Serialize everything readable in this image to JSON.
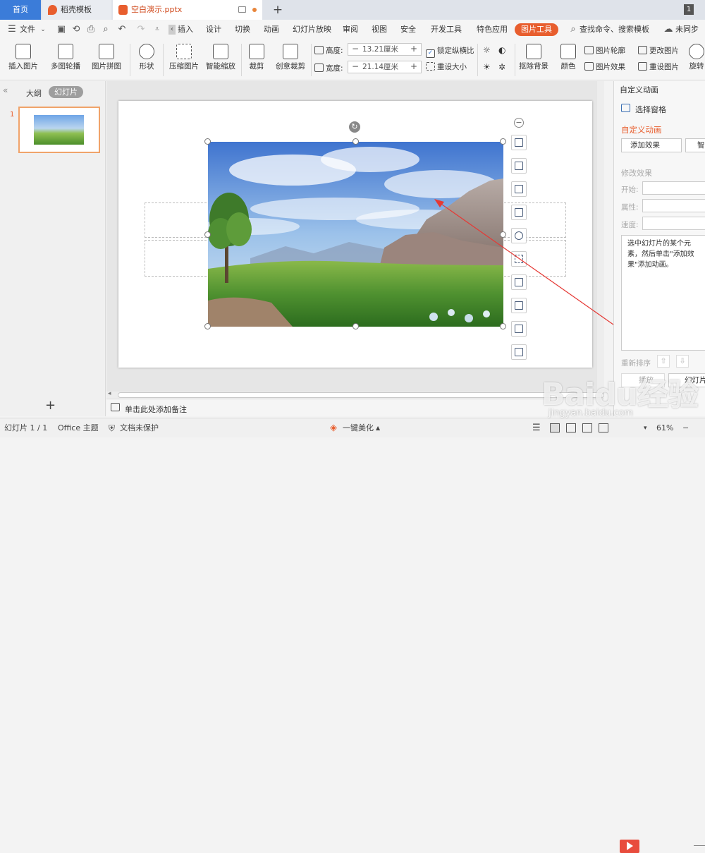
{
  "tabs": {
    "home": "首页",
    "daoke": "稻壳模板",
    "doc": "空白演示.pptx",
    "add": "+",
    "window_count": "1"
  },
  "menu": {
    "file": "文件",
    "items": [
      "插入",
      "设计",
      "切换",
      "动画",
      "幻灯片放映",
      "审阅",
      "视图",
      "安全",
      "开发工具",
      "特色应用"
    ],
    "active": "图片工具",
    "search": "查找命令、搜索模板",
    "sync": "未同步"
  },
  "ribbon": {
    "insert_pic": "插入图片",
    "multi_outline": "多图轮播",
    "pic_collage": "图片拼图",
    "shape": "形状",
    "compress": "压缩图片",
    "smart_scale": "智能缩放",
    "crop": "裁剪",
    "creative_crop": "创意裁剪",
    "height_label": "高度:",
    "height_value": "13.21厘米",
    "width_label": "宽度:",
    "width_value": "21.14厘米",
    "lock_ratio": "锁定纵横比",
    "reset_size": "重设大小",
    "remove_bg": "抠除背景",
    "color": "颜色",
    "pic_outline": "图片轮廓",
    "pic_effect": "图片效果",
    "change_pic": "更改图片",
    "reset_pic": "重设图片",
    "rotate": "旋转"
  },
  "left_pane": {
    "outline_tab": "大纲",
    "slides_tab": "幻灯片",
    "slide_number": "1",
    "add_slide": "+"
  },
  "notes": {
    "placeholder": "单击此处添加备注"
  },
  "right_pane": {
    "header": "自定义动画",
    "select_pane": "选择窗格",
    "section_title": "自定义动画",
    "add_effect": "添加效果",
    "smart_btn": "智",
    "modify_title": "修改效果",
    "start_label": "开始:",
    "property_label": "属性:",
    "speed_label": "速度:",
    "hint": "选中幻灯片的某个元素，然后单击\"添加效果\"添加动画。",
    "reorder": "重新排序",
    "play_btn": "播放",
    "slideshow_btn": "幻灯片"
  },
  "status": {
    "slide_pos": "幻灯片 1 / 1",
    "theme": "Office 主题",
    "protect": "文档未保护",
    "beautify": "一键美化",
    "zoom": "61%"
  },
  "watermark": {
    "brand": "Baidu经验",
    "url": "jingyan.baidu.com"
  },
  "colors": {
    "accent": "#e85e2e",
    "home_tab": "#3b7cd9",
    "play": "#e84c3d",
    "arrow": "#e53935"
  }
}
